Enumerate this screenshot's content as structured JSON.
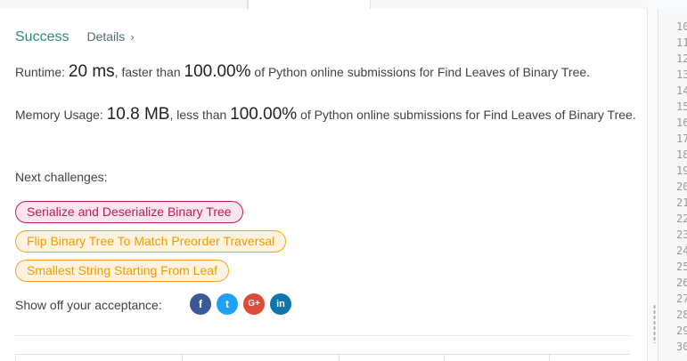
{
  "result": {
    "status": "Success",
    "details_label": "Details",
    "details_chevron": "›"
  },
  "runtime": {
    "label": "Runtime:",
    "value": "20 ms",
    "faster_text": ", faster than ",
    "percent": "100.00%",
    "suffix": " of Python online submissions for Find Leaves of Binary Tree."
  },
  "memory": {
    "label": "Memory Usage:",
    "value": "10.8 MB",
    "less_text": ", less than ",
    "percent": "100.00%",
    "suffix": " of Python online submissions for Find Leaves of Binary Tree."
  },
  "next_challenges": {
    "label": "Next challenges:",
    "items": [
      {
        "title": "Serialize and Deserialize Binary Tree",
        "difficulty": "hard",
        "color": "#c2185b"
      },
      {
        "title": "Flip Binary Tree To Match Preorder Traversal",
        "difficulty": "medium",
        "color": "#f29b00"
      },
      {
        "title": "Smallest String Starting From Leaf",
        "difficulty": "medium",
        "color": "#f29b00"
      }
    ]
  },
  "share": {
    "label": "Show off your acceptance:",
    "icons": [
      {
        "name": "facebook-icon",
        "glyph": "f",
        "color": "#3b5998"
      },
      {
        "name": "twitter-icon",
        "glyph": "t",
        "color": "#1da1f2"
      },
      {
        "name": "google-plus-icon",
        "glyph": "G+",
        "color": "#dd4b39"
      },
      {
        "name": "linkedin-icon",
        "glyph": "in",
        "color": "#0e76a8"
      }
    ]
  },
  "editor": {
    "line_numbers": [
      "10",
      "11",
      "12",
      "13",
      "14",
      "15",
      "16",
      "17",
      "18",
      "19",
      "20",
      "21",
      "22",
      "23",
      "24",
      "25",
      "26",
      "27",
      "28",
      "29",
      "30"
    ]
  }
}
